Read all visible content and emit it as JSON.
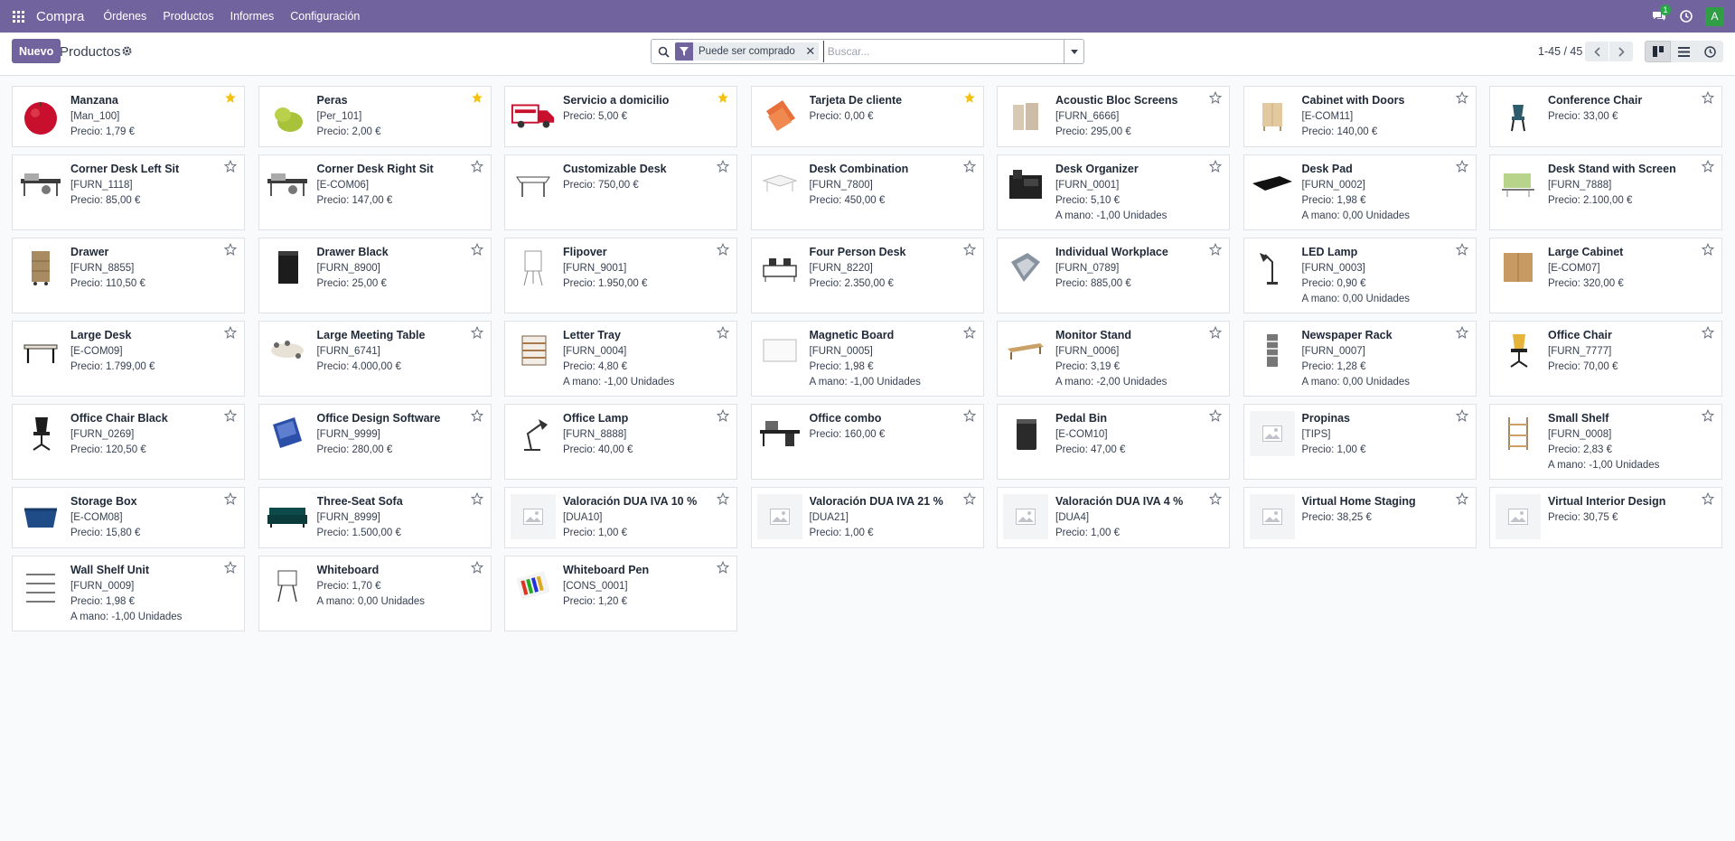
{
  "navbar": {
    "app_name": "Compra",
    "menu": [
      "Órdenes",
      "Productos",
      "Informes",
      "Configuración"
    ],
    "chat_badge": "1",
    "avatar_letter": "A",
    "color": "#71639e"
  },
  "control": {
    "new_button": "Nuevo",
    "title": "Productos",
    "facet_label": "Puede ser comprado",
    "search_placeholder": "Buscar...",
    "pager": "1-45 / 45"
  },
  "products": [
    {
      "name": "Manzana",
      "ref": "[Man_100]",
      "price": "Precio: 1,79 €",
      "onhand": "",
      "fav": true,
      "img": "apple"
    },
    {
      "name": "Peras",
      "ref": "[Per_101]",
      "price": "Precio: 2,00 €",
      "onhand": "",
      "fav": true,
      "img": "pear"
    },
    {
      "name": "Servicio a domicilio",
      "ref": "",
      "price": "Precio: 5,00 €",
      "onhand": "",
      "fav": true,
      "img": "truck"
    },
    {
      "name": "Tarjeta De cliente",
      "ref": "",
      "price": "Precio: 0,00 €",
      "onhand": "",
      "fav": true,
      "img": "card"
    },
    {
      "name": "Acoustic Bloc Screens",
      "ref": "[FURN_6666]",
      "price": "Precio: 295,00 €",
      "onhand": "",
      "fav": false,
      "img": "screens"
    },
    {
      "name": "Cabinet with Doors",
      "ref": "[E-COM11]",
      "price": "Precio: 140,00 €",
      "onhand": "",
      "fav": false,
      "img": "cabinet"
    },
    {
      "name": "Conference Chair",
      "ref": "",
      "price": "Precio: 33,00 €",
      "onhand": "",
      "fav": false,
      "img": "chair"
    },
    {
      "name": "Corner Desk Left Sit",
      "ref": "[FURN_1118]",
      "price": "Precio: 85,00 €",
      "onhand": "",
      "fav": false,
      "img": "desk"
    },
    {
      "name": "Corner Desk Right Sit",
      "ref": "[E-COM06]",
      "price": "Precio: 147,00 €",
      "onhand": "",
      "fav": false,
      "img": "desk"
    },
    {
      "name": "Customizable Desk",
      "ref": "",
      "price": "Precio: 750,00 €",
      "onhand": "",
      "fav": false,
      "img": "table"
    },
    {
      "name": "Desk Combination",
      "ref": "[FURN_7800]",
      "price": "Precio: 450,00 €",
      "onhand": "",
      "fav": false,
      "img": "combo"
    },
    {
      "name": "Desk Organizer",
      "ref": "[FURN_0001]",
      "price": "Precio: 5,10 €",
      "onhand": "A mano: -1,00 Unidades",
      "fav": false,
      "img": "organizer"
    },
    {
      "name": "Desk Pad",
      "ref": "[FURN_0002]",
      "price": "Precio: 1,98 €",
      "onhand": "A mano: 0,00 Unidades",
      "fav": false,
      "img": "pad"
    },
    {
      "name": "Desk Stand with Screen",
      "ref": "[FURN_7888]",
      "price": "Precio: 2.100,00 €",
      "onhand": "",
      "fav": false,
      "img": "stand"
    },
    {
      "name": "Drawer",
      "ref": "[FURN_8855]",
      "price": "Precio: 110,50 €",
      "onhand": "",
      "fav": false,
      "img": "drawer"
    },
    {
      "name": "Drawer Black",
      "ref": "[FURN_8900]",
      "price": "Precio: 25,00 €",
      "onhand": "",
      "fav": false,
      "img": "drawer-black"
    },
    {
      "name": "Flipover",
      "ref": "[FURN_9001]",
      "price": "Precio: 1.950,00 €",
      "onhand": "",
      "fav": false,
      "img": "flipover"
    },
    {
      "name": "Four Person Desk",
      "ref": "[FURN_8220]",
      "price": "Precio: 2.350,00 €",
      "onhand": "",
      "fav": false,
      "img": "four-desk"
    },
    {
      "name": "Individual Workplace",
      "ref": "[FURN_0789]",
      "price": "Precio: 885,00 €",
      "onhand": "",
      "fav": false,
      "img": "workplace"
    },
    {
      "name": "LED Lamp",
      "ref": "[FURN_0003]",
      "price": "Precio: 0,90 €",
      "onhand": "A mano: 0,00 Unidades",
      "fav": false,
      "img": "lamp"
    },
    {
      "name": "Large Cabinet",
      "ref": "[E-COM07]",
      "price": "Precio: 320,00 €",
      "onhand": "",
      "fav": false,
      "img": "large-cabinet"
    },
    {
      "name": "Large Desk",
      "ref": "[E-COM09]",
      "price": "Precio: 1.799,00 €",
      "onhand": "",
      "fav": false,
      "img": "large-desk"
    },
    {
      "name": "Large Meeting Table",
      "ref": "[FURN_6741]",
      "price": "Precio: 4.000,00 €",
      "onhand": "",
      "fav": false,
      "img": "meeting"
    },
    {
      "name": "Letter Tray",
      "ref": "[FURN_0004]",
      "price": "Precio: 4,80 €",
      "onhand": "A mano: -1,00 Unidades",
      "fav": false,
      "img": "tray"
    },
    {
      "name": "Magnetic Board",
      "ref": "[FURN_0005]",
      "price": "Precio: 1,98 €",
      "onhand": "A mano: -1,00 Unidades",
      "fav": false,
      "img": "board"
    },
    {
      "name": "Monitor Stand",
      "ref": "[FURN_0006]",
      "price": "Precio: 3,19 €",
      "onhand": "A mano: -2,00 Unidades",
      "fav": false,
      "img": "monitor-stand"
    },
    {
      "name": "Newspaper Rack",
      "ref": "[FURN_0007]",
      "price": "Precio: 1,28 €",
      "onhand": "A mano: 0,00 Unidades",
      "fav": false,
      "img": "rack"
    },
    {
      "name": "Office Chair",
      "ref": "[FURN_7777]",
      "price": "Precio: 70,00 €",
      "onhand": "",
      "fav": false,
      "img": "office-chair"
    },
    {
      "name": "Office Chair Black",
      "ref": "[FURN_0269]",
      "price": "Precio: 120,50 €",
      "onhand": "",
      "fav": false,
      "img": "chair-black"
    },
    {
      "name": "Office Design Software",
      "ref": "[FURN_9999]",
      "price": "Precio: 280,00 €",
      "onhand": "",
      "fav": false,
      "img": "software"
    },
    {
      "name": "Office Lamp",
      "ref": "[FURN_8888]",
      "price": "Precio: 40,00 €",
      "onhand": "",
      "fav": false,
      "img": "office-lamp"
    },
    {
      "name": "Office combo",
      "ref": "",
      "price": "Precio: 160,00 €",
      "onhand": "",
      "fav": false,
      "img": "office-combo"
    },
    {
      "name": "Pedal Bin",
      "ref": "[E-COM10]",
      "price": "Precio: 47,00 €",
      "onhand": "",
      "fav": false,
      "img": "bin"
    },
    {
      "name": "Propinas",
      "ref": "[TIPS]",
      "price": "Precio: 1,00 €",
      "onhand": "",
      "fav": false,
      "img": "placeholder"
    },
    {
      "name": "Small Shelf",
      "ref": "[FURN_0008]",
      "price": "Precio: 2,83 €",
      "onhand": "A mano: -1,00 Unidades",
      "fav": false,
      "img": "shelf"
    },
    {
      "name": "Storage Box",
      "ref": "[E-COM08]",
      "price": "Precio: 15,80 €",
      "onhand": "",
      "fav": false,
      "img": "box"
    },
    {
      "name": "Three-Seat Sofa",
      "ref": "[FURN_8999]",
      "price": "Precio: 1.500,00 €",
      "onhand": "",
      "fav": false,
      "img": "sofa"
    },
    {
      "name": "Valoración DUA IVA 10 %",
      "ref": "[DUA10]",
      "price": "Precio: 1,00 €",
      "onhand": "",
      "fav": false,
      "img": "placeholder"
    },
    {
      "name": "Valoración DUA IVA 21 %",
      "ref": "[DUA21]",
      "price": "Precio: 1,00 €",
      "onhand": "",
      "fav": false,
      "img": "placeholder"
    },
    {
      "name": "Valoración DUA IVA 4 %",
      "ref": "[DUA4]",
      "price": "Precio: 1,00 €",
      "onhand": "",
      "fav": false,
      "img": "placeholder"
    },
    {
      "name": "Virtual Home Staging",
      "ref": "",
      "price": "Precio: 38,25 €",
      "onhand": "",
      "fav": false,
      "img": "placeholder"
    },
    {
      "name": "Virtual Interior Design",
      "ref": "",
      "price": "Precio: 30,75 €",
      "onhand": "",
      "fav": false,
      "img": "placeholder"
    },
    {
      "name": "Wall Shelf Unit",
      "ref": "[FURN_0009]",
      "price": "Precio: 1,98 €",
      "onhand": "A mano: -1,00 Unidades",
      "fav": false,
      "img": "wall-shelf"
    },
    {
      "name": "Whiteboard",
      "ref": "",
      "price": "Precio: 1,70 €",
      "onhand": "A mano: 0,00 Unidades",
      "fav": false,
      "img": "whiteboard"
    },
    {
      "name": "Whiteboard Pen",
      "ref": "[CONS_0001]",
      "price": "Precio: 1,20 €",
      "onhand": "",
      "fav": false,
      "img": "pens"
    }
  ]
}
